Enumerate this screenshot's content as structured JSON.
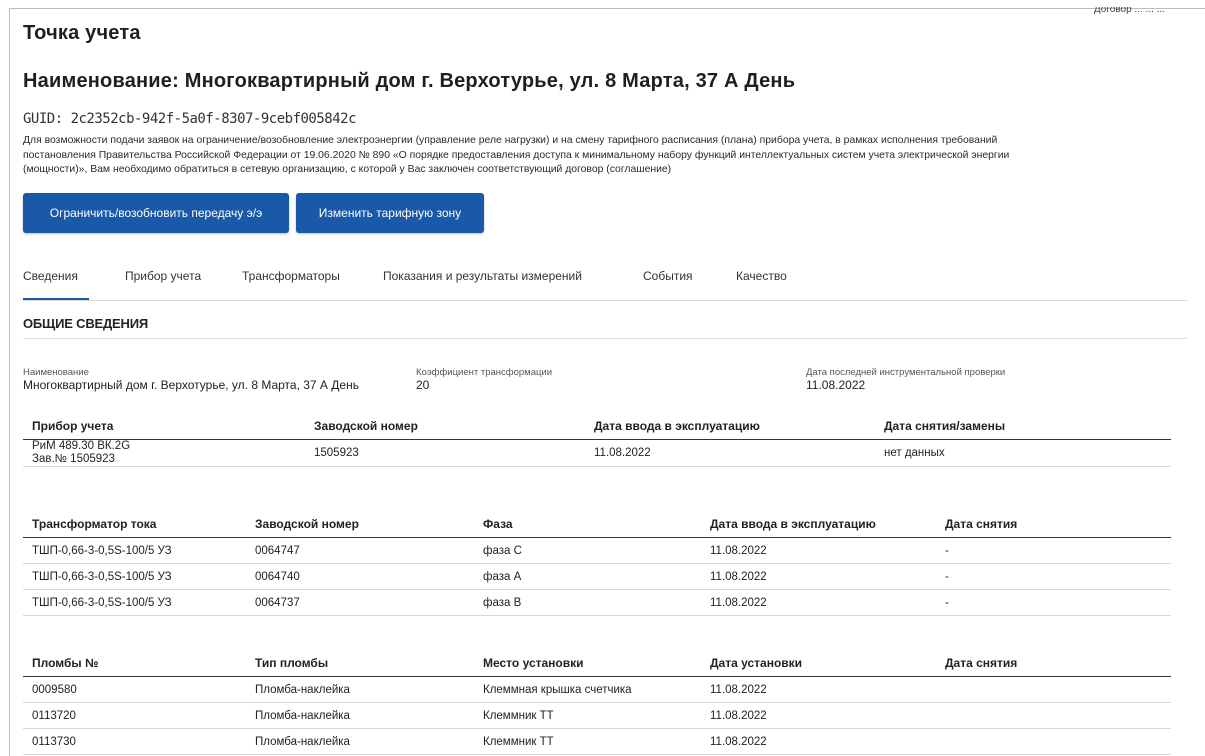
{
  "header": {
    "clipped_text": "Договор ...  ...  ...",
    "page_title": "Точка учета",
    "object_title": "Наименование: Многоквартирный дом г. Верхотурье, ул. 8 Марта, 37 А День",
    "guid": "GUID: 2c2352cb-942f-5a0f-8307-9cebf005842c"
  },
  "notice": {
    "line1": "Для возможности подачи заявок на ограничение/возобновление электроэнергии (управление реле нагрузки) и на смену тарифного расписания (плана) прибора учета, в рамках исполнения требований",
    "line2": "постановления Правительства Российской Федерации от 19.06.2020 № 890 «О порядке предоставления доступа к минимальному набору функций интеллектуальных систем учета электрической энергии",
    "line3": "(мощности)», Вам необходимо обратиться в сетевую организацию, с которой у Вас заключен соответствующий договор (соглашение)"
  },
  "buttons": {
    "limit": "Ограничить/возобновить передачу э/э",
    "tariff": "Изменить тарифную зону"
  },
  "tabs": [
    "Сведения",
    "Прибор учета",
    "Трансформаторы",
    "Показания и результаты измерений",
    "События",
    "Качество"
  ],
  "section": {
    "title": "ОБЩИЕ СВЕДЕНИЯ"
  },
  "info": {
    "name_label": "Наименование",
    "name_value": "Многоквартирный дом г. Верхотурье, ул. 8 Марта, 37 А День",
    "coef_label": "Коэффициент трансформации",
    "coef_value": "20",
    "check_label": "Дата последней инструментальной проверки",
    "check_value": "11.08.2022"
  },
  "meter_table": {
    "headers": [
      "Прибор учета",
      "Заводской номер",
      "Дата ввода в эксплуатацию",
      "Дата снятия/замены"
    ],
    "row": {
      "device_line1": "РиМ 489.30 ВК.2G",
      "device_line2": "Зав.№ 1505923",
      "serial": "1505923",
      "commission_date": "11.08.2022",
      "removal": "нет данных"
    }
  },
  "transformer_table": {
    "headers": [
      "Трансформатор тока",
      "Заводской номер",
      "Фаза",
      "Дата ввода в эксплуатацию",
      "Дата снятия"
    ],
    "rows": [
      [
        "ТШП-0,66-3-0,5S-100/5 УЗ",
        "0064747",
        "фаза С",
        "11.08.2022",
        "-"
      ],
      [
        "ТШП-0,66-3-0,5S-100/5 УЗ",
        "0064740",
        "фаза А",
        "11.08.2022",
        "-"
      ],
      [
        "ТШП-0,66-3-0,5S-100/5 УЗ",
        "0064737",
        "фаза В",
        "11.08.2022",
        "-"
      ]
    ]
  },
  "seals_table": {
    "headers": [
      "Пломбы №",
      "Тип пломбы",
      "Место установки",
      "Дата установки",
      "Дата снятия"
    ],
    "rows": [
      [
        "0009580",
        "Пломба-наклейка",
        "Клеммная крышка счетчика",
        "11.08.2022",
        ""
      ],
      [
        "0113720",
        "Пломба-наклейка",
        "Клеммник ТТ",
        "11.08.2022",
        ""
      ],
      [
        "0113730",
        "Пломба-наклейка",
        "Клеммник ТТ",
        "11.08.2022",
        ""
      ]
    ]
  },
  "colors": {
    "accent": "#1a58a8",
    "text": "#1f1f1f"
  }
}
